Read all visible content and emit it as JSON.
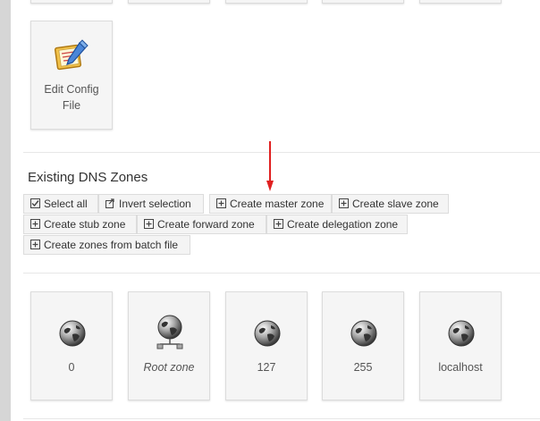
{
  "config_tile": {
    "label_line1": "Edit Config",
    "label_line2": "File"
  },
  "section": {
    "title": "Existing DNS Zones"
  },
  "buttons": {
    "select_all": "Select all",
    "invert_selection": "Invert selection",
    "create_master": "Create master zone",
    "create_slave": "Create slave zone",
    "create_stub": "Create stub zone",
    "create_forward": "Create forward zone",
    "create_delegation": "Create delegation zone",
    "create_batch": "Create zones from batch file"
  },
  "zones": [
    {
      "label": "0",
      "icon": "globe-icon"
    },
    {
      "label": "Root zone",
      "icon": "globe-network-icon"
    },
    {
      "label": "127",
      "icon": "globe-icon"
    },
    {
      "label": "255",
      "icon": "globe-icon"
    },
    {
      "label": "localhost",
      "icon": "globe-icon"
    }
  ],
  "colors": {
    "accent_arrow": "#e02020",
    "tile_bg": "#f5f5f5",
    "left_bar": "#d6d6d6"
  }
}
